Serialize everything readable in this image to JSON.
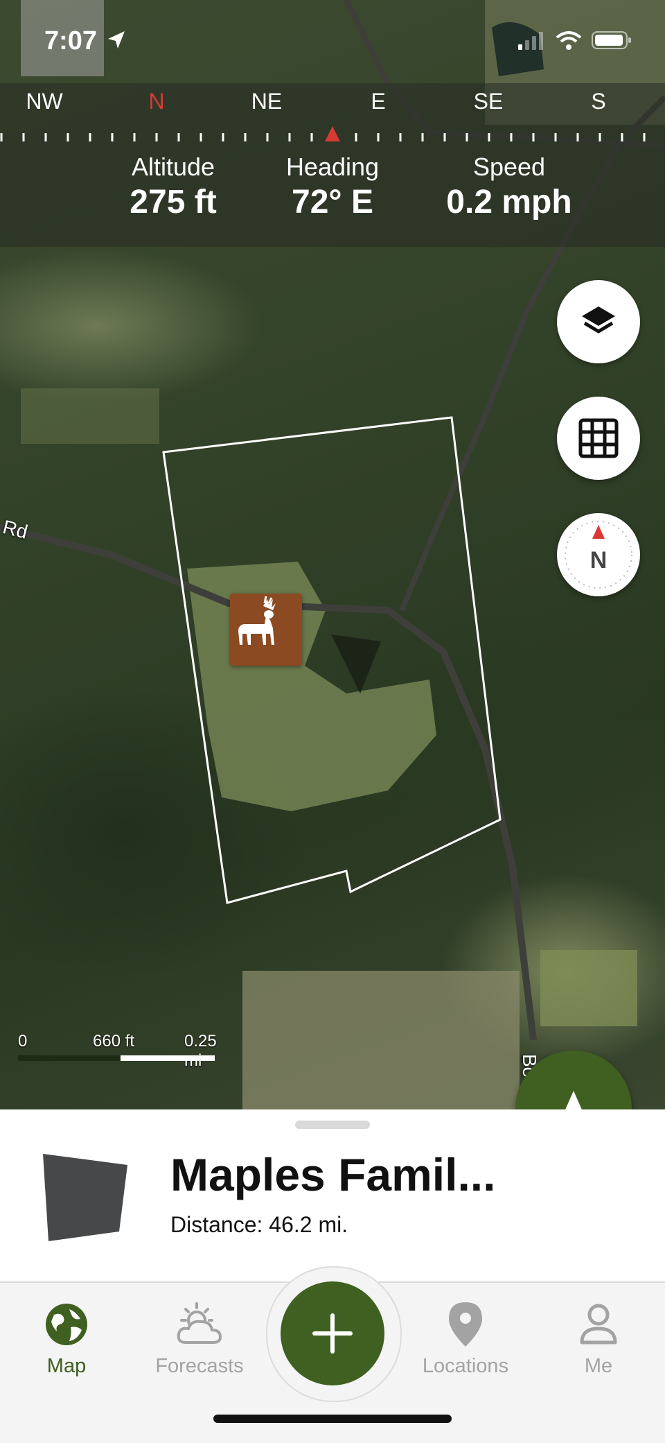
{
  "status_bar": {
    "time": "7:07",
    "icons": [
      "location-arrow-icon",
      "cellular-signal-icon",
      "wifi-icon",
      "battery-icon"
    ]
  },
  "compass": {
    "directions": [
      "NW",
      "N",
      "NE",
      "E",
      "SE",
      "S"
    ],
    "north_color": "#d83a32"
  },
  "metrics": {
    "altitude": {
      "label": "Altitude",
      "value": "275 ft"
    },
    "heading": {
      "label": "Heading",
      "value": "72° E"
    },
    "speed": {
      "label": "Speed",
      "value": "0.2 mph"
    }
  },
  "map": {
    "road_labels": [
      "Rd",
      "Bo"
    ],
    "scale": {
      "zero": "0",
      "feet": "660 ft",
      "miles": "0.25 mi"
    },
    "map_buttons": [
      "layers-icon",
      "grid-icon",
      "compass-north-icon"
    ],
    "compass_button_letter": "N",
    "marker_icon": "deer-icon",
    "marker_color": "#8b4a22"
  },
  "sheet": {
    "title": "Maples Famil...",
    "subtitle": "Distance: 46.2 mi."
  },
  "tabs": [
    {
      "label": "Map",
      "icon": "globe-icon",
      "active": true
    },
    {
      "label": "Forecasts",
      "icon": "weather-icon",
      "active": false
    },
    {
      "label": "Locations",
      "icon": "location-pin-icon",
      "active": false
    },
    {
      "label": "Me",
      "icon": "person-icon",
      "active": false
    }
  ],
  "colors": {
    "accent": "#3f6020",
    "inactive": "#a3a3a3"
  }
}
